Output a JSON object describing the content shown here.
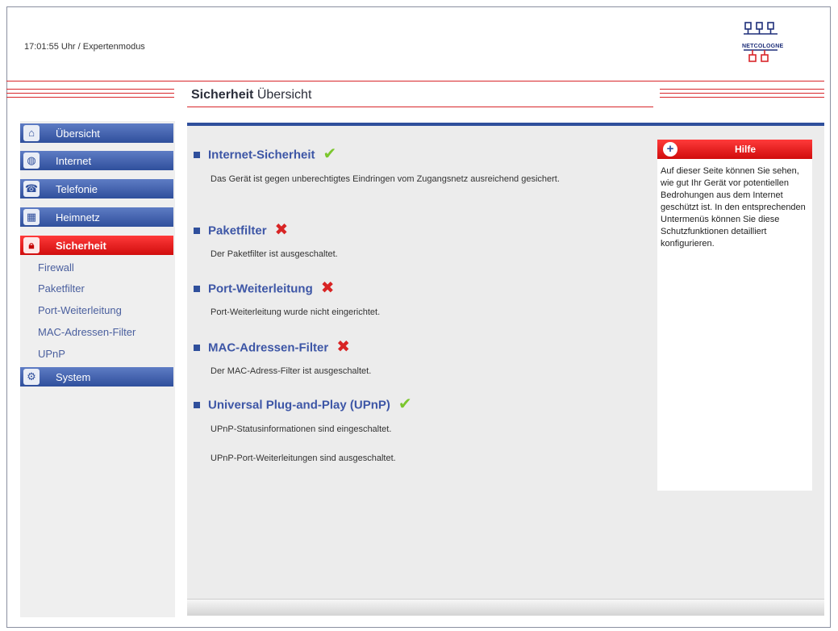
{
  "header": {
    "status": "17:01:55 Uhr  / Expertenmodus",
    "logo_text": "NETCOLOGNE"
  },
  "page": {
    "title_bold": "Sicherheit",
    "title_rest": "Übersicht"
  },
  "sidebar": {
    "items": [
      {
        "label": "Übersicht",
        "icon": "home-icon"
      },
      {
        "label": "Internet",
        "icon": "globe-icon"
      },
      {
        "label": "Telefonie",
        "icon": "phone-icon"
      },
      {
        "label": "Heimnetz",
        "icon": "network-icon"
      },
      {
        "label": "Sicherheit",
        "icon": "lock-icon"
      },
      {
        "label": "System",
        "icon": "gears-icon"
      }
    ],
    "sub_items": [
      "Firewall",
      "Paketfilter",
      "Port-Weiterleitung",
      "MAC-Adressen-Filter",
      "UPnP"
    ]
  },
  "sections": [
    {
      "title": "Internet-Sicherheit",
      "status": "ok",
      "desc": [
        "Das Gerät ist gegen unberechtigtes Eindringen vom Zugangsnetz ausreichend gesichert."
      ]
    },
    {
      "title": "Paketfilter",
      "status": "bad",
      "desc": [
        "Der Paketfilter ist ausgeschaltet."
      ]
    },
    {
      "title": "Port-Weiterleitung",
      "status": "bad",
      "desc": [
        "Port-Weiterleitung wurde nicht eingerichtet."
      ]
    },
    {
      "title": "MAC-Adressen-Filter",
      "status": "bad",
      "desc": [
        "Der MAC-Adress-Filter ist ausgeschaltet."
      ]
    },
    {
      "title": "Universal Plug-and-Play (UPnP)",
      "status": "ok",
      "desc": [
        "UPnP-Statusinformationen sind eingeschaltet.",
        "UPnP-Port-Weiterleitungen sind ausgeschaltet."
      ]
    }
  ],
  "help": {
    "title": "Hilfe",
    "text": "Auf dieser Seite können Sie sehen, wie gut Ihr Gerät vor potentiellen Bedrohungen aus dem Internet geschützt ist. In den entsprechenden Untermenüs können Sie diese Schutzfunktionen detailliert konfigurieren."
  },
  "colors": {
    "nav_blue": "#2f4f9c",
    "active_red": "#d00d0d",
    "ok_green": "#7bc62d",
    "bad_red": "#d82424"
  }
}
